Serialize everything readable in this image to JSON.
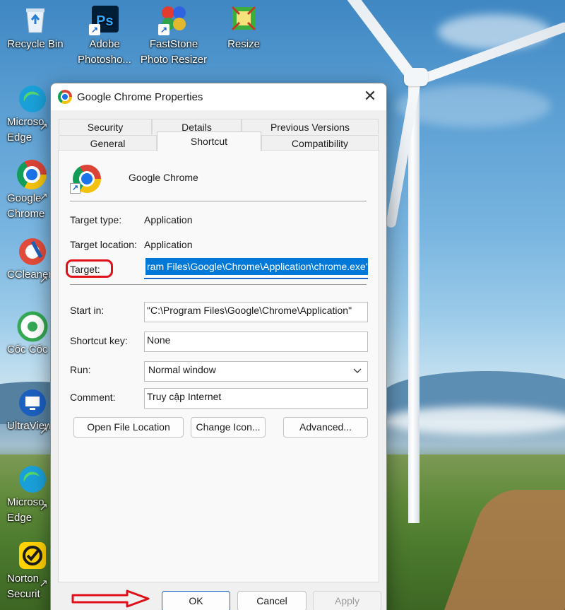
{
  "desktop": {
    "icons": [
      {
        "label": "Recycle Bin"
      },
      {
        "label": "Adobe Photosho..."
      },
      {
        "label": "FastStone Photo Resizer"
      },
      {
        "label": "Resize"
      }
    ],
    "left_icons": [
      {
        "label": "Microso Edge"
      },
      {
        "label": "Google Chrome"
      },
      {
        "label": "CCleaner"
      },
      {
        "label": "Cốc Cốc"
      },
      {
        "label": "UltraView"
      },
      {
        "label": "Microso Edge"
      },
      {
        "label": "Norton Securit"
      }
    ]
  },
  "dialog": {
    "title": "Google Chrome Properties",
    "close_label": "✕",
    "tabs_row1": [
      "Security",
      "Details",
      "Previous Versions"
    ],
    "tabs_row2": [
      "General",
      "Shortcut",
      "Compatibility"
    ],
    "active_tab": "Shortcut",
    "app_name": "Google Chrome",
    "fields": {
      "target_type_label": "Target type:",
      "target_type_value": "Application",
      "target_location_label": "Target location:",
      "target_location_value": "Application",
      "target_label": "Target:",
      "target_value": "ram Files\\Google\\Chrome\\Application\\chrome.exe\"",
      "start_in_label": "Start in:",
      "start_in_value": "\"C:\\Program Files\\Google\\Chrome\\Application\"",
      "shortcut_key_label": "Shortcut key:",
      "shortcut_key_value": "None",
      "run_label": "Run:",
      "run_value": "Normal window",
      "comment_label": "Comment:",
      "comment_value": "Truy cập Internet"
    },
    "buttons": {
      "open_file_location": "Open File Location",
      "change_icon": "Change Icon...",
      "advanced": "Advanced...",
      "ok": "OK",
      "cancel": "Cancel",
      "apply": "Apply"
    }
  },
  "colors": {
    "annotation": "#e0101a",
    "accent": "#0078d7"
  }
}
